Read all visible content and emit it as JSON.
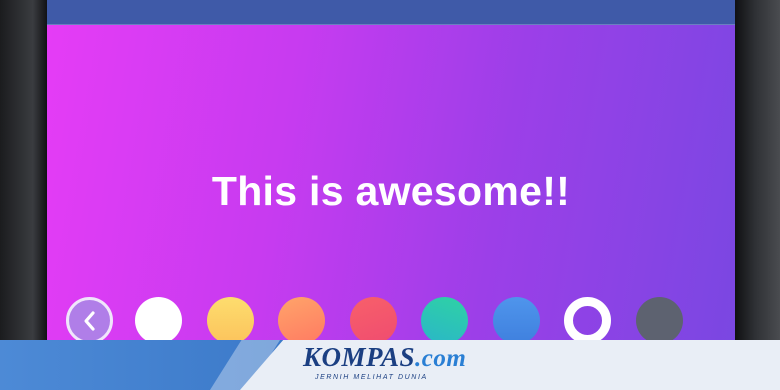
{
  "post": {
    "text": "This is awesome!!"
  },
  "background_picker": {
    "back_icon": "chevron-left-icon",
    "swatches": [
      {
        "name": "white",
        "color": "#ffffff"
      },
      {
        "name": "yellow",
        "color": "#fdd065"
      },
      {
        "name": "orange",
        "color": "#ff8a66"
      },
      {
        "name": "red",
        "color": "#f4566c"
      },
      {
        "name": "teal",
        "color": "#2fc7b6"
      },
      {
        "name": "blue",
        "color": "#4a8ee8"
      },
      {
        "name": "gradient-selected",
        "color": "#ffffff"
      },
      {
        "name": "gray",
        "color": "#5d6270"
      }
    ]
  },
  "banner": {
    "brand_main": "KOMPAS",
    "brand_suffix": ".com",
    "tagline": "JERNIH MELIHAT DUNIA"
  }
}
